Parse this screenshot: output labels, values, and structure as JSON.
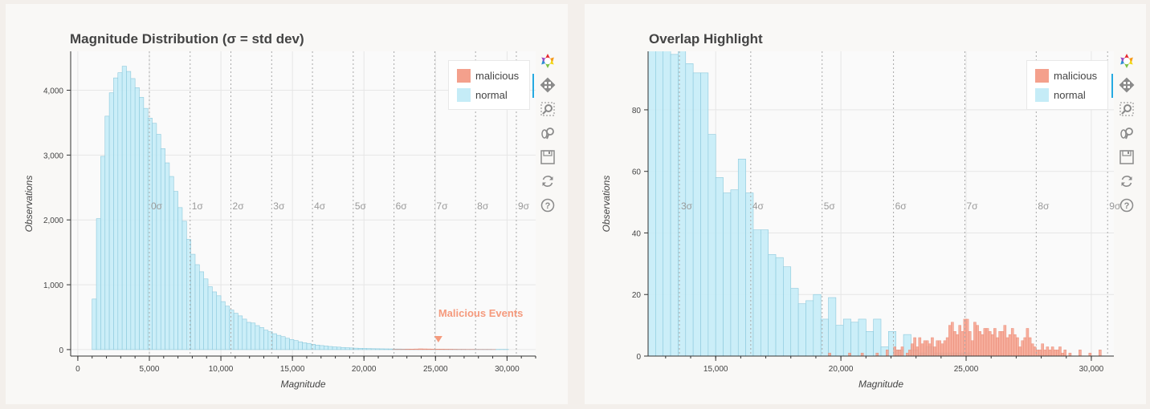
{
  "colors": {
    "malicious": "#f4a08c",
    "malicious_line": "#e8826c",
    "normal": "#c5ecf7",
    "normal_line": "#8cc9dc",
    "annotation": "#f59a7d",
    "sigma_label": "#9a9a9a"
  },
  "toolbar": {
    "tools": [
      {
        "name": "bokeh-logo-icon"
      },
      {
        "name": "pan-icon"
      },
      {
        "name": "box-zoom-icon"
      },
      {
        "name": "wheel-zoom-icon"
      },
      {
        "name": "save-icon"
      },
      {
        "name": "reset-icon"
      },
      {
        "name": "help-icon"
      }
    ]
  },
  "legend": {
    "malicious": "malicious",
    "normal": "normal"
  },
  "chart_data": [
    {
      "type": "bar",
      "title": "Magnitude Distribution (σ = std dev)",
      "xlabel": "Magnitude",
      "ylabel": "Observations",
      "xlim": [
        -500,
        32000
      ],
      "ylim": [
        -100,
        4600
      ],
      "xticks": [
        0,
        5000,
        10000,
        15000,
        20000,
        25000,
        30000
      ],
      "xtick_labels": [
        "0",
        "5,000",
        "10,000",
        "15,000",
        "20,000",
        "25,000",
        "30,000"
      ],
      "yticks": [
        0,
        1000,
        2000,
        3000,
        4000
      ],
      "ytick_labels": [
        "0",
        "1,000",
        "2,000",
        "3,000",
        "4,000"
      ],
      "grid": true,
      "legend_position": "top-right",
      "sigma_lines": {
        "x": [
          5000,
          7850,
          10700,
          13550,
          16400,
          19250,
          22100,
          24950,
          27800,
          30650
        ],
        "labels": [
          "0σ",
          "1σ",
          "2σ",
          "3σ",
          "4σ",
          "5σ",
          "6σ",
          "7σ",
          "8σ",
          "9σ"
        ]
      },
      "annotation": {
        "text": "Malicious Events",
        "x": 25200,
        "y": 0
      },
      "series": [
        {
          "name": "normal",
          "bin_start": 1000,
          "bin_width": 300,
          "values": [
            780,
            2020,
            2980,
            3600,
            3960,
            4190,
            4270,
            4370,
            4290,
            4180,
            4040,
            3890,
            3720,
            3570,
            3490,
            3320,
            3100,
            2880,
            2670,
            2440,
            2190,
            1980,
            1700,
            1470,
            1310,
            1200,
            1090,
            970,
            890,
            830,
            740,
            670,
            610,
            560,
            520,
            470,
            420,
            410,
            370,
            340,
            300,
            275,
            245,
            220,
            200,
            175,
            155,
            140,
            120,
            105,
            95,
            82,
            70,
            62,
            55,
            48,
            42,
            38,
            33,
            29,
            26,
            22,
            20,
            18,
            16,
            14,
            13,
            12,
            11,
            10,
            9,
            9,
            8,
            8,
            7,
            7,
            7,
            6,
            6,
            6,
            6,
            5,
            5,
            5,
            5,
            5,
            5,
            4,
            4,
            4,
            4,
            4,
            4,
            3,
            3,
            3,
            3
          ]
        },
        {
          "name": "malicious",
          "bin_start": 22000,
          "bin_width": 300,
          "values": [
            2,
            3,
            4,
            6,
            8,
            10,
            12,
            11,
            10,
            9,
            8,
            7,
            6,
            5,
            4,
            3,
            3,
            2,
            2,
            1,
            1,
            1,
            1,
            1
          ]
        }
      ]
    },
    {
      "type": "bar",
      "title": "Overlap Highlight",
      "xlabel": "Magnitude",
      "ylabel": "Observations",
      "xlim": [
        12300,
        30900
      ],
      "ylim": [
        0,
        99
      ],
      "xticks": [
        15000,
        20000,
        25000,
        30000
      ],
      "xtick_labels": [
        "15,000",
        "20,000",
        "25,000",
        "30,000"
      ],
      "yticks": [
        0,
        20,
        40,
        60,
        80
      ],
      "ytick_labels": [
        "0",
        "20",
        "40",
        "60",
        "80"
      ],
      "grid": true,
      "legend_position": "top-right",
      "sigma_lines": {
        "x": [
          13550,
          16400,
          19250,
          22100,
          24950,
          27800,
          30650
        ],
        "labels": [
          "3σ",
          "4σ",
          "5σ",
          "6σ",
          "7σ",
          "8σ",
          "9σ"
        ]
      },
      "series": [
        {
          "name": "normal",
          "bin_start": 12300,
          "bin_width": 300,
          "values": [
            110,
            105,
            100,
            98,
            100,
            95,
            92,
            92,
            72,
            58,
            53,
            54,
            64,
            53,
            41,
            41,
            33,
            32,
            29,
            22,
            17,
            18,
            20,
            12,
            19,
            10,
            12,
            11,
            12,
            8,
            12,
            3,
            8,
            2,
            7,
            2,
            1,
            3,
            1,
            1,
            1,
            1,
            1
          ]
        },
        {
          "name": "malicious",
          "bin_start": 19500,
          "values": [
            [
              19500,
              1
            ],
            [
              20300,
              1
            ],
            [
              20800,
              1
            ],
            [
              21400,
              1
            ],
            [
              21800,
              2
            ],
            [
              22100,
              3
            ],
            [
              22300,
              2
            ],
            [
              22600,
              1
            ],
            [
              22800,
              4
            ],
            [
              23000,
              3
            ],
            [
              23300,
              5
            ],
            [
              23500,
              4
            ],
            [
              23700,
              3
            ],
            [
              23900,
              5
            ],
            [
              22200,
              2
            ],
            [
              22400,
              3
            ],
            [
              22700,
              2
            ],
            [
              22900,
              6
            ],
            [
              23100,
              6
            ],
            [
              23200,
              4
            ],
            [
              23400,
              5
            ],
            [
              23600,
              6
            ],
            [
              23800,
              5
            ],
            [
              24000,
              4
            ],
            [
              24100,
              5
            ],
            [
              24200,
              6
            ],
            [
              24300,
              10
            ],
            [
              24400,
              11
            ],
            [
              24500,
              8
            ],
            [
              24600,
              7
            ],
            [
              24700,
              10
            ],
            [
              24800,
              8
            ],
            [
              24900,
              12
            ],
            [
              25000,
              12
            ],
            [
              25100,
              8
            ],
            [
              25200,
              5
            ],
            [
              25300,
              11
            ],
            [
              25400,
              10
            ],
            [
              25500,
              8
            ],
            [
              25600,
              7
            ],
            [
              25700,
              9
            ],
            [
              25800,
              9
            ],
            [
              25900,
              8
            ],
            [
              26000,
              7
            ],
            [
              26100,
              9
            ],
            [
              26200,
              6
            ],
            [
              26300,
              8
            ],
            [
              26400,
              8
            ],
            [
              26500,
              10
            ],
            [
              26600,
              6
            ],
            [
              26700,
              7
            ],
            [
              26800,
              9
            ],
            [
              26900,
              7
            ],
            [
              27000,
              6
            ],
            [
              27100,
              3
            ],
            [
              27200,
              5
            ],
            [
              27300,
              6
            ],
            [
              27400,
              9
            ],
            [
              27500,
              6
            ],
            [
              27600,
              4
            ],
            [
              27700,
              3
            ],
            [
              27800,
              2
            ],
            [
              27900,
              2
            ],
            [
              28000,
              4
            ],
            [
              28100,
              2
            ],
            [
              28200,
              3
            ],
            [
              28300,
              2
            ],
            [
              28400,
              3
            ],
            [
              28500,
              2
            ],
            [
              28600,
              2
            ],
            [
              28700,
              3
            ],
            [
              28800,
              1
            ],
            [
              28900,
              2
            ],
            [
              29100,
              1
            ],
            [
              29500,
              2
            ],
            [
              29900,
              1
            ],
            [
              30300,
              2
            ]
          ]
        }
      ]
    }
  ]
}
